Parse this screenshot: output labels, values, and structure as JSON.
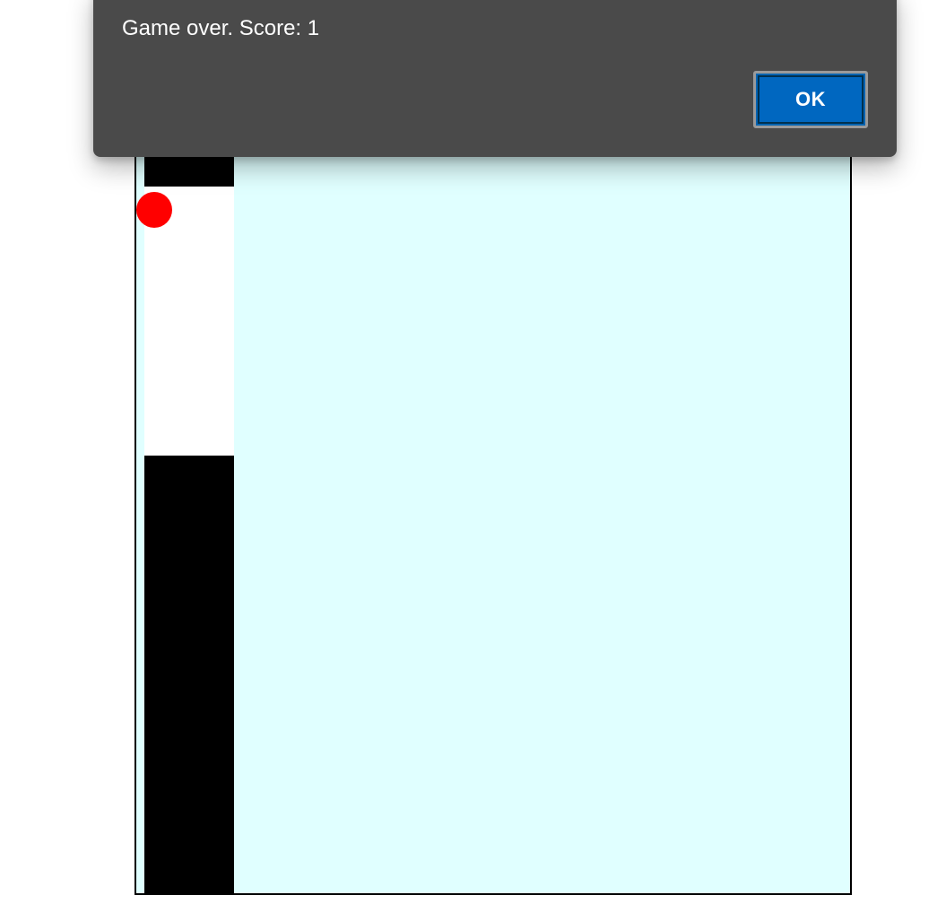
{
  "dialog": {
    "message": "Game over. Score: 1",
    "ok_label": "OK"
  },
  "game": {
    "score": 1,
    "colors": {
      "sky": "#e0ffff",
      "pipe": "#000000",
      "gap": "#ffffff",
      "bird": "#ff0000",
      "border": "#000000"
    }
  },
  "colors": {
    "dialog_background": "#4a4a4a",
    "button_background": "#0067c0",
    "button_border": "#9a9a9a",
    "text": "#ffffff"
  }
}
